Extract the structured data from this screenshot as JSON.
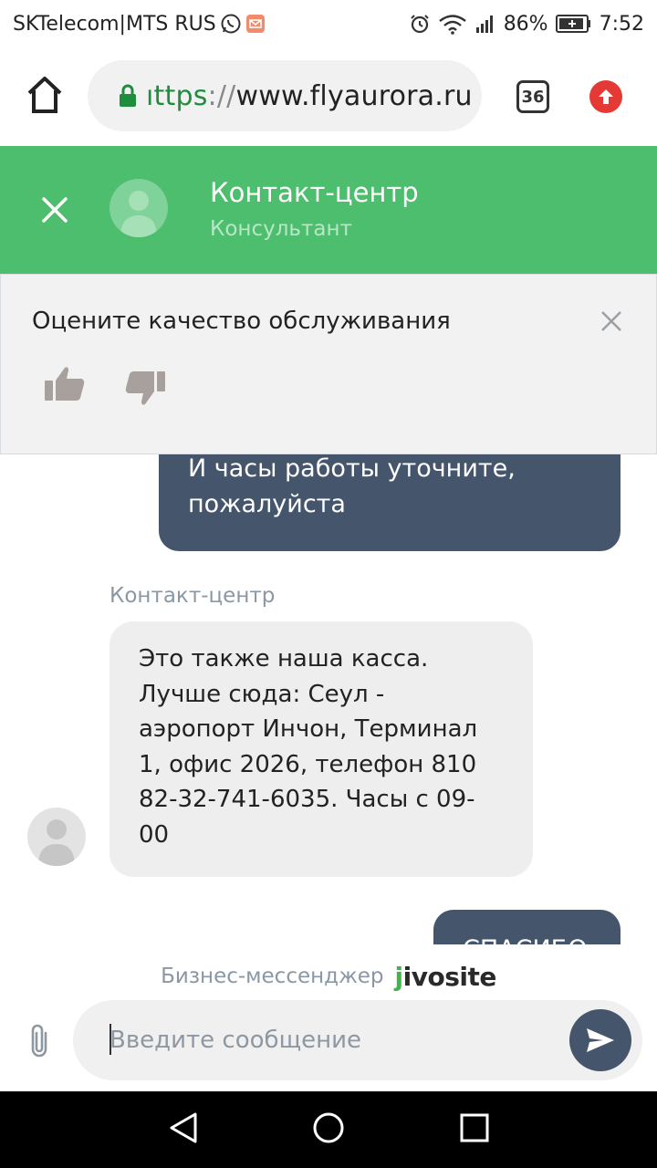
{
  "status_bar": {
    "carrier": "SKTelecom|MTS RUS",
    "battery": "86%",
    "time": "7:52",
    "icons": [
      "whatsapp-icon",
      "mail-icon",
      "alarm-icon",
      "wifi-icon",
      "signal-icon",
      "battery-icon"
    ]
  },
  "browser": {
    "url_scheme": "ıttps",
    "url_sep": "://",
    "url_host": "www.flyaurora.ru",
    "tab_count": "36",
    "icons": [
      "home-icon",
      "lock-icon",
      "upload-icon"
    ]
  },
  "chat_header": {
    "title": "Контакт-центр",
    "subtitle": "Консультант",
    "accent_color": "#4dbd6e"
  },
  "rating": {
    "title": "Оцените качество обслуживания"
  },
  "messages": {
    "outgoing_1": [
      "И часы работы уточните,",
      "пожалуйста"
    ],
    "sender": "Контакт-центр",
    "incoming_1": [
      "Это также наша касса.",
      "Лучше сюда: Сеул -",
      "аэропорт Инчон, Терминал",
      "1, офис 2026, телефон 810",
      "82-32-741-6035. Часы с 09-",
      "00"
    ],
    "outgoing_2": "СПАСИБО",
    "outgoing_color": "#45566c"
  },
  "footer": {
    "powered_text": "Бизнес-мессенджер",
    "logo_j": "j",
    "logo_rest": "ivosite",
    "input_placeholder": "Введите сообщение"
  }
}
